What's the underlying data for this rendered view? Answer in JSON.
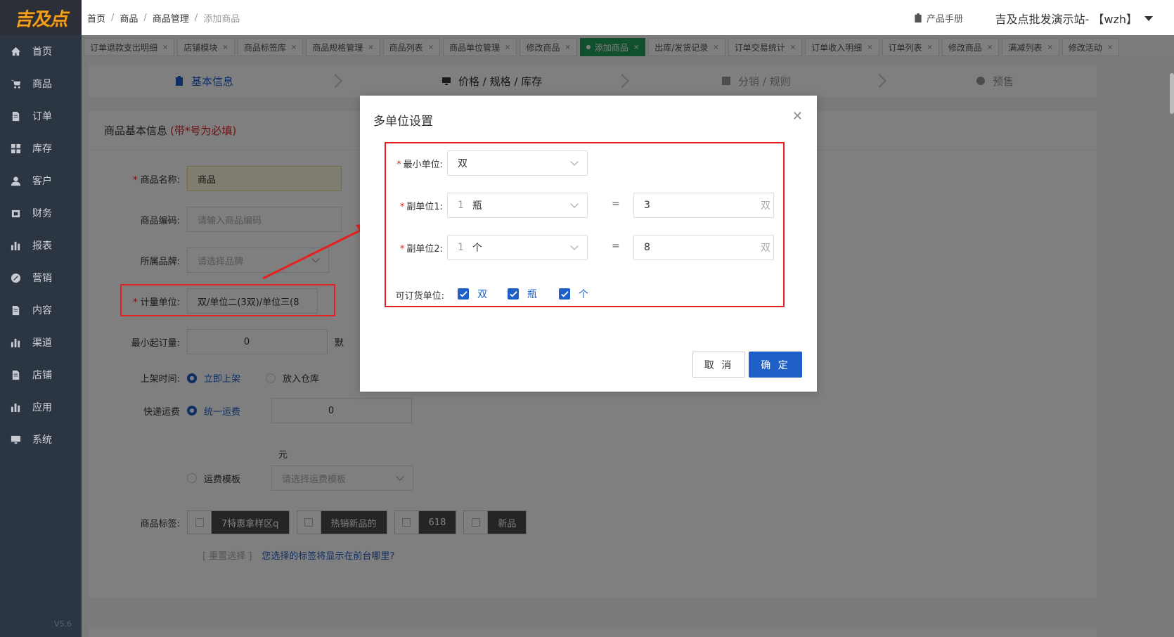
{
  "logo": {
    "text": "吉及点"
  },
  "sidebar": {
    "items": [
      {
        "label": "首页",
        "icon": "home-icon"
      },
      {
        "label": "商品",
        "icon": "cart-icon"
      },
      {
        "label": "订单",
        "icon": "doc-icon"
      },
      {
        "label": "库存",
        "icon": "grid-icon"
      },
      {
        "label": "客户",
        "icon": "user-icon"
      },
      {
        "label": "财务",
        "icon": "wallet-icon"
      },
      {
        "label": "报表",
        "icon": "bar-chart-icon"
      },
      {
        "label": "营销",
        "icon": "percent-icon"
      },
      {
        "label": "内容",
        "icon": "doc-icon"
      },
      {
        "label": "渠道",
        "icon": "bar-chart-icon"
      },
      {
        "label": "店铺",
        "icon": "doc-icon"
      },
      {
        "label": "应用",
        "icon": "bar-chart-icon"
      },
      {
        "label": "系统",
        "icon": "monitor-icon"
      }
    ],
    "version": "V5.6"
  },
  "breadcrumb": [
    "首页",
    "商品",
    "商品管理",
    "添加商品"
  ],
  "header": {
    "manual": "产品手册",
    "store": "吉及点批发演示站- 【wzh】"
  },
  "tabs": [
    {
      "label": "订单退款支出明细"
    },
    {
      "label": "店铺模块"
    },
    {
      "label": "商品标签库"
    },
    {
      "label": "商品规格管理"
    },
    {
      "label": "商品列表"
    },
    {
      "label": "商品单位管理"
    },
    {
      "label": "修改商品"
    },
    {
      "label": "添加商品",
      "active": true
    },
    {
      "label": "出库/发货记录"
    },
    {
      "label": "订单交易统计"
    },
    {
      "label": "订单收入明细"
    },
    {
      "label": "订单列表"
    },
    {
      "label": "修改商品"
    },
    {
      "label": "满减列表"
    },
    {
      "label": "修改活动"
    }
  ],
  "steps": [
    {
      "label": "基本信息",
      "icon": "clipboard-icon"
    },
    {
      "label": "价格 / 规格 / 库存",
      "icon": "monitor-icon"
    },
    {
      "label": "分销 / 规则",
      "icon": "check-square-icon"
    },
    {
      "label": "预售",
      "icon": "circle-icon"
    }
  ],
  "panel": {
    "title": "商品基本信息",
    "required_note": "(带*号为必填)",
    "name_label": "商品名称:",
    "name_value": "商品",
    "code_label": "商品编码:",
    "code_placeholder": "请输入商品编码",
    "brand_label": "所属品牌:",
    "brand_placeholder": "请选择品牌",
    "unit_label": "计量单位:",
    "unit_value": "双/单位二(3双)/单位三(8",
    "min_order_label": "最小起订量:",
    "min_order_value": "0",
    "min_order_suffix": "默",
    "shelf_label": "上架时间:",
    "shelf_opt1": "立即上架",
    "shelf_opt2": "放入仓库",
    "ship_label": "快递运费",
    "ship_opt1": "统一运费",
    "ship_value": "0",
    "ship_unit": "元",
    "ship_opt2": "运费模板",
    "ship_tpl_placeholder": "请选择运费模板",
    "tags_label": "商品标签:",
    "tags": [
      "7特惠拿样区q",
      "热销新品的",
      "618",
      "新品"
    ],
    "reset": "[ 重置选择 ]",
    "tag_help": "您选择的标签将显示在前台哪里?"
  },
  "modal": {
    "title": "多单位设置",
    "min_unit_label": "最小单位:",
    "min_unit_value": "双",
    "sub1_label": "副单位1:",
    "sub1_qty": "1",
    "sub1_unit": "瓶",
    "sub1_value": "3",
    "sub1_suffix": "双",
    "sub2_label": "副单位2:",
    "sub2_qty": "1",
    "sub2_unit": "个",
    "sub2_value": "8",
    "sub2_suffix": "双",
    "equals": "=",
    "orderable_label": "可订货单位:",
    "orderable": [
      "双",
      "瓶",
      "个"
    ],
    "cancel": "取 消",
    "confirm": "确 定"
  },
  "colors": {
    "primary": "#1e5fc8",
    "active_tab": "#22a05a",
    "highlight": "#e62020",
    "sidebar": "#2c3542"
  }
}
